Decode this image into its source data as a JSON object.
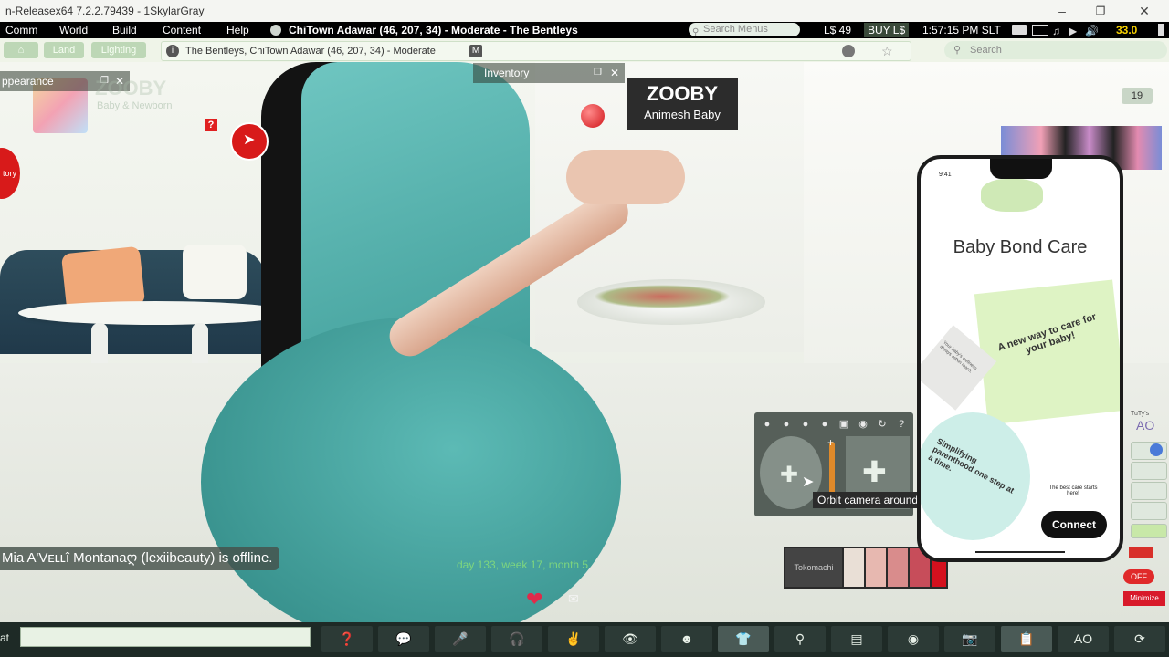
{
  "window": {
    "title": "n-Releasex64 7.2.2.79439 - 1SkylarGray",
    "minimize": "–",
    "maximize": "❐",
    "close": "✕"
  },
  "menubar": {
    "items": [
      "Comm",
      "World",
      "Build",
      "Content",
      "Help"
    ],
    "location": "ChiTown Adawar (46, 207, 34) - Moderate - The Bentleys",
    "search_placeholder": "Search Menus",
    "balance": "L$ 49",
    "buy": "BUY L$",
    "time": "1:57:15 PM SLT",
    "fps": "33.0"
  },
  "navbar": {
    "land_label": "Land",
    "lighting_label": "Lighting",
    "url": "The Bentleys, ChiTown Adawar (46, 207, 34) - Moderate",
    "maturity": "M",
    "search_placeholder": "Search"
  },
  "floaters": {
    "appearance": "ppearance",
    "inventory": "Inventory"
  },
  "scene": {
    "sign_title": "ZOOBY",
    "sign_subtitle": "Animesh Baby",
    "faded_sign_title": "ZOOBY",
    "faded_sign_subtitle": "Baby & Newborn",
    "red_badge": "tory",
    "counter_badge": "19",
    "hud_text": "day 133, week 17, month 5",
    "tooltip": "Orbit camera around focus",
    "notification": "Mia A'Vᴇʟʟî Montanaღ (lexiibeauty) is offline.",
    "hud_brand": "Tokomachi"
  },
  "phone": {
    "time": "9:41",
    "title": "Baby Bond Care",
    "card_green": "A new way to care for your baby!",
    "card_grey": "Your baby's wellness always within reach.",
    "circle_text": "Simplifying parenthood one step at a time.",
    "small_text": "The best care starts here!",
    "connect": "Connect"
  },
  "right_hud": {
    "ao_label": "AO",
    "brand": "TuTy's",
    "off": "OFF",
    "minimize": "Minimize"
  },
  "bottombar": {
    "chat_label": "at",
    "ao_label": "AO"
  },
  "colors": {
    "menu_bg": "#000000",
    "accent_green": "#bdd7b6",
    "toolbar_bg": "#1e2a26",
    "hud_green": "#7ed67e"
  }
}
